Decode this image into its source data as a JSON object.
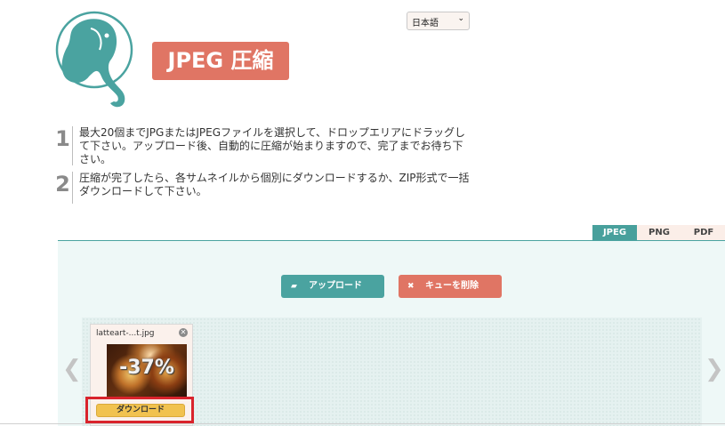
{
  "language": {
    "selected": "日本語"
  },
  "header": {
    "title": "JPEG 圧縮"
  },
  "steps": [
    {
      "number": "1",
      "text": "最大20個までJPGまたはJPEGファイルを選択して、ドロップエリアにドラッグして下さい。アップロード後、自動的に圧縮が始まりますので、完了までお待ち下さい。"
    },
    {
      "number": "2",
      "text": "圧縮が完了したら、各サムネイルから個別にダウンロードするか、ZIP形式で一括ダウンロードして下さい。"
    }
  ],
  "tabs": [
    {
      "label": "JPEG",
      "active": true
    },
    {
      "label": "PNG",
      "active": false
    },
    {
      "label": "PDF",
      "active": false
    }
  ],
  "actions": {
    "upload_label": "アップロード",
    "clear_label": "キューを削除"
  },
  "queue": {
    "items": [
      {
        "filename": "latteart-...t.jpg",
        "reduction": "-37%",
        "download_label": "ダウンロード"
      }
    ]
  },
  "nav": {
    "prev": "❮",
    "next": "❯"
  },
  "colors": {
    "teal": "#4aa3a0",
    "coral": "#e07564",
    "download": "#f1c24f",
    "highlight": "#d9232c"
  }
}
